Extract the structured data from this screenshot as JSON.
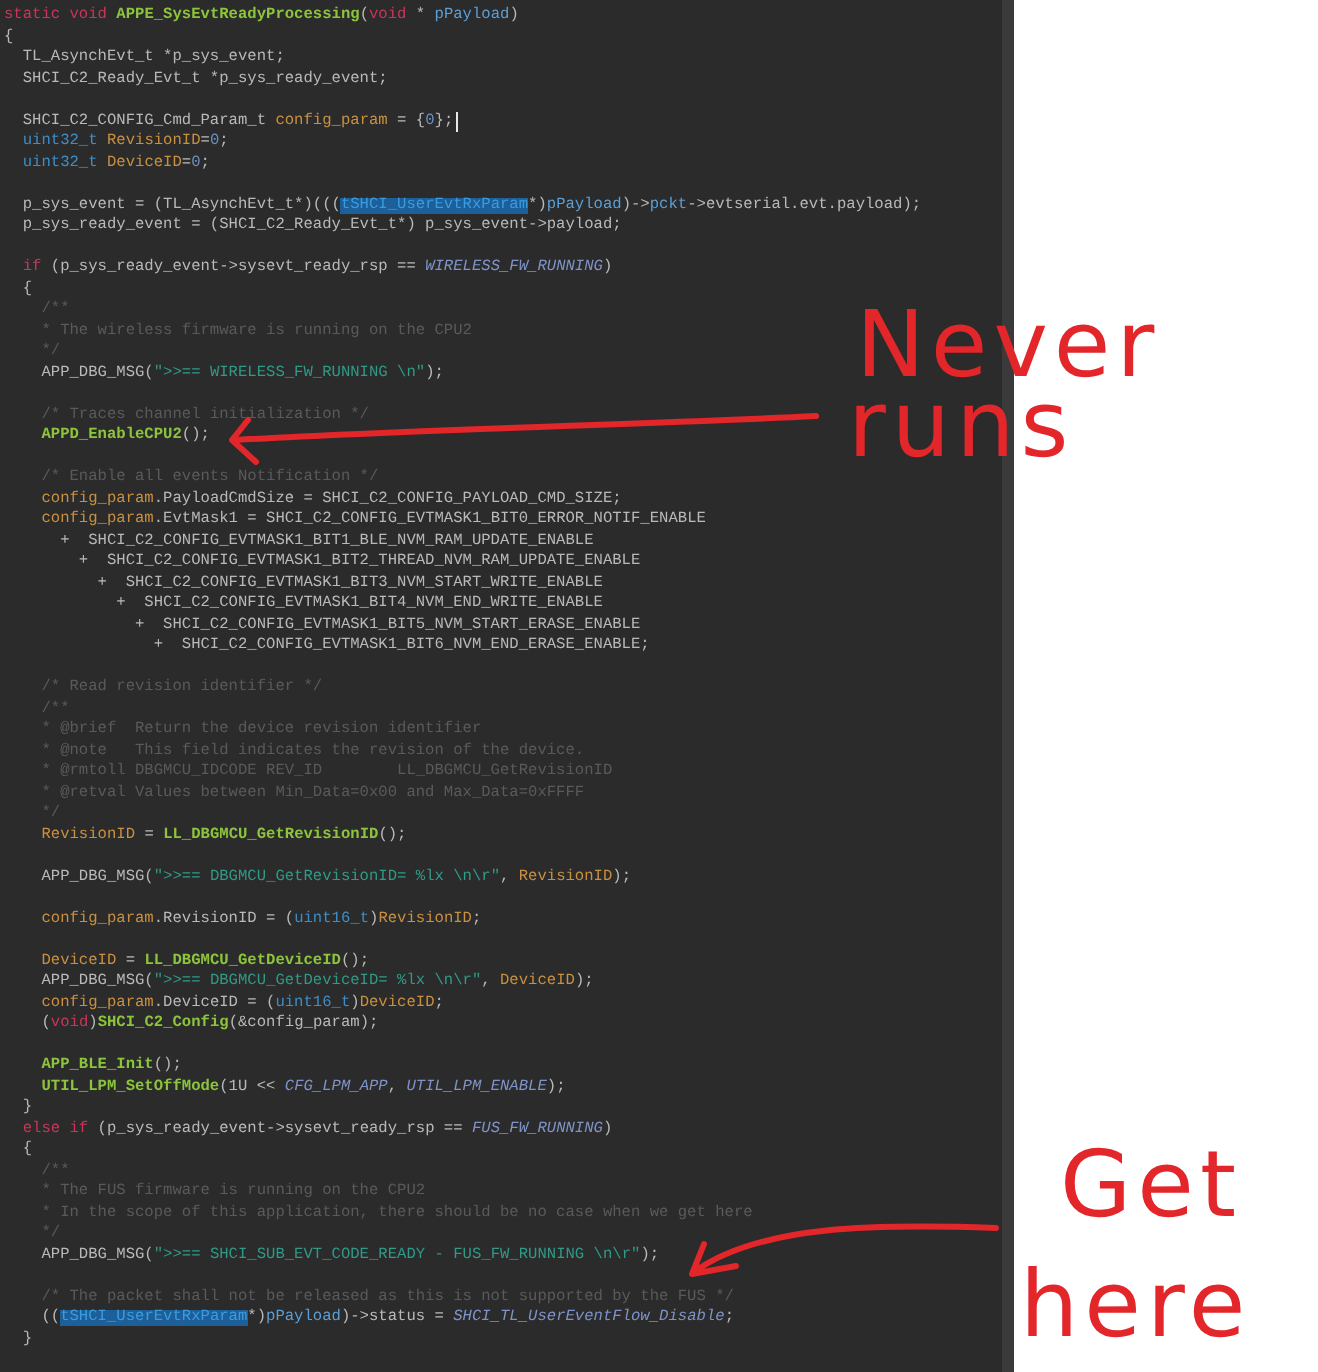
{
  "editor": {
    "lines": [
      {
        "kind": "code",
        "segments": [
          {
            "text": "static void ",
            "kind": "keyword"
          },
          {
            "text": "APPE_SysEvtReadyProcessing",
            "kind": "func"
          },
          {
            "text": "(",
            "kind": "plain"
          },
          {
            "text": "void",
            "kind": "keyword"
          },
          {
            "text": " * ",
            "kind": "plain"
          },
          {
            "text": "pPayload",
            "kind": "param"
          },
          {
            "text": ")",
            "kind": "plain"
          }
        ]
      },
      {
        "kind": "code",
        "segments": [
          {
            "text": "{",
            "kind": "plain"
          }
        ]
      },
      {
        "kind": "code",
        "segments": [
          {
            "text": "  TL_AsynchEvt_t *p_sys_event;",
            "kind": "plain"
          }
        ]
      },
      {
        "kind": "code",
        "segments": [
          {
            "text": "  SHCI_C2_Ready_Evt_t *p_sys_ready_event;",
            "kind": "plain"
          }
        ]
      },
      {
        "kind": "blank"
      },
      {
        "kind": "code",
        "cursor": true,
        "segments": [
          {
            "text": "  SHCI_C2_CONFIG_Cmd_Param_t ",
            "kind": "plain"
          },
          {
            "text": "config_param",
            "kind": "var"
          },
          {
            "text": " = {",
            "kind": "plain"
          },
          {
            "text": "0",
            "kind": "number"
          },
          {
            "text": "};",
            "kind": "plain"
          }
        ]
      },
      {
        "kind": "code",
        "segments": [
          {
            "text": "  uint32_t",
            "kind": "type"
          },
          {
            "text": " RevisionID",
            "kind": "var"
          },
          {
            "text": "=",
            "kind": "plain"
          },
          {
            "text": "0",
            "kind": "number"
          },
          {
            "text": ";",
            "kind": "plain"
          }
        ]
      },
      {
        "kind": "code",
        "segments": [
          {
            "text": "  uint32_t",
            "kind": "type"
          },
          {
            "text": " DeviceID",
            "kind": "var"
          },
          {
            "text": "=",
            "kind": "plain"
          },
          {
            "text": "0",
            "kind": "number"
          },
          {
            "text": ";",
            "kind": "plain"
          }
        ]
      },
      {
        "kind": "blank"
      },
      {
        "kind": "code",
        "segments": [
          {
            "text": "  p_sys_event = (TL_AsynchEvt_t*)(((",
            "kind": "plain"
          },
          {
            "text": "tSHCI_UserEvtRxParam",
            "kind": "selected"
          },
          {
            "text": "*)",
            "kind": "plain"
          },
          {
            "text": "pPayload",
            "kind": "param"
          },
          {
            "text": ")->",
            "kind": "plain"
          },
          {
            "text": "pckt",
            "kind": "param"
          },
          {
            "text": "->evtserial.evt.payload);",
            "kind": "plain"
          }
        ]
      },
      {
        "kind": "code",
        "segments": [
          {
            "text": "  p_sys_ready_event = (SHCI_C2_Ready_Evt_t*) p_sys_event->payload;",
            "kind": "plain"
          }
        ]
      },
      {
        "kind": "blank"
      },
      {
        "kind": "code",
        "segments": [
          {
            "text": "  if",
            "kind": "keyword"
          },
          {
            "text": " (p_sys_ready_event->sysevt_ready_rsp == ",
            "kind": "plain"
          },
          {
            "text": "WIRELESS_FW_RUNNING",
            "kind": "const"
          },
          {
            "text": ")",
            "kind": "plain"
          }
        ]
      },
      {
        "kind": "code",
        "segments": [
          {
            "text": "  {",
            "kind": "plain"
          }
        ]
      },
      {
        "kind": "code",
        "segments": [
          {
            "text": "    /**",
            "kind": "comment"
          }
        ]
      },
      {
        "kind": "code",
        "segments": [
          {
            "text": "    * The wireless firmware is running on the CPU2",
            "kind": "comment"
          }
        ]
      },
      {
        "kind": "code",
        "segments": [
          {
            "text": "    */",
            "kind": "comment"
          }
        ]
      },
      {
        "kind": "code",
        "segments": [
          {
            "text": "    APP_DBG_MSG(",
            "kind": "plain"
          },
          {
            "text": "\">>== WIRELESS_FW_RUNNING \\n\"",
            "kind": "string"
          },
          {
            "text": ");",
            "kind": "plain"
          }
        ]
      },
      {
        "kind": "blank"
      },
      {
        "kind": "code",
        "segments": [
          {
            "text": "    /* Traces channel initialization */",
            "kind": "comment"
          }
        ]
      },
      {
        "kind": "code",
        "segments": [
          {
            "text": "    APPD_EnableCPU2",
            "kind": "func"
          },
          {
            "text": "();",
            "kind": "plain"
          }
        ]
      },
      {
        "kind": "blank"
      },
      {
        "kind": "code",
        "segments": [
          {
            "text": "    /* Enable all events Notification */",
            "kind": "comment"
          }
        ]
      },
      {
        "kind": "code",
        "segments": [
          {
            "text": "    config_param",
            "kind": "var"
          },
          {
            "text": ".PayloadCmdSize = SHCI_C2_CONFIG_PAYLOAD_CMD_SIZE;",
            "kind": "plain"
          }
        ]
      },
      {
        "kind": "code",
        "segments": [
          {
            "text": "    config_param",
            "kind": "var"
          },
          {
            "text": ".EvtMask1 = SHCI_C2_CONFIG_EVTMASK1_BIT0_ERROR_NOTIF_ENABLE",
            "kind": "plain"
          }
        ]
      },
      {
        "kind": "code",
        "segments": [
          {
            "text": "      +  SHCI_C2_CONFIG_EVTMASK1_BIT1_BLE_NVM_RAM_UPDATE_ENABLE",
            "kind": "plain"
          }
        ]
      },
      {
        "kind": "code",
        "segments": [
          {
            "text": "        +  SHCI_C2_CONFIG_EVTMASK1_BIT2_THREAD_NVM_RAM_UPDATE_ENABLE",
            "kind": "plain"
          }
        ]
      },
      {
        "kind": "code",
        "segments": [
          {
            "text": "          +  SHCI_C2_CONFIG_EVTMASK1_BIT3_NVM_START_WRITE_ENABLE",
            "kind": "plain"
          }
        ]
      },
      {
        "kind": "code",
        "segments": [
          {
            "text": "            +  SHCI_C2_CONFIG_EVTMASK1_BIT4_NVM_END_WRITE_ENABLE",
            "kind": "plain"
          }
        ]
      },
      {
        "kind": "code",
        "segments": [
          {
            "text": "              +  SHCI_C2_CONFIG_EVTMASK1_BIT5_NVM_START_ERASE_ENABLE",
            "kind": "plain"
          }
        ]
      },
      {
        "kind": "code",
        "segments": [
          {
            "text": "                +  SHCI_C2_CONFIG_EVTMASK1_BIT6_NVM_END_ERASE_ENABLE;",
            "kind": "plain"
          }
        ]
      },
      {
        "kind": "blank"
      },
      {
        "kind": "code",
        "segments": [
          {
            "text": "    /* Read revision identifier */",
            "kind": "comment"
          }
        ]
      },
      {
        "kind": "code",
        "segments": [
          {
            "text": "    /**",
            "kind": "comment"
          }
        ]
      },
      {
        "kind": "code",
        "segments": [
          {
            "text": "    * @brief  Return the device revision identifier",
            "kind": "comment"
          }
        ]
      },
      {
        "kind": "code",
        "segments": [
          {
            "text": "    * @note   This field indicates the revision of the device.",
            "kind": "comment"
          }
        ]
      },
      {
        "kind": "code",
        "segments": [
          {
            "text": "    * @rmtoll DBGMCU_IDCODE REV_ID        LL_DBGMCU_GetRevisionID",
            "kind": "comment"
          }
        ]
      },
      {
        "kind": "code",
        "segments": [
          {
            "text": "    * @retval Values between Min_Data=0x00 and Max_Data=0xFFFF",
            "kind": "comment"
          }
        ]
      },
      {
        "kind": "code",
        "segments": [
          {
            "text": "    */",
            "kind": "comment"
          }
        ]
      },
      {
        "kind": "code",
        "segments": [
          {
            "text": "    RevisionID",
            "kind": "var"
          },
          {
            "text": " = ",
            "kind": "plain"
          },
          {
            "text": "LL_DBGMCU_GetRevisionID",
            "kind": "func"
          },
          {
            "text": "();",
            "kind": "plain"
          }
        ]
      },
      {
        "kind": "blank"
      },
      {
        "kind": "code",
        "segments": [
          {
            "text": "    APP_DBG_MSG(",
            "kind": "plain"
          },
          {
            "text": "\">>== DBGMCU_GetRevisionID= %lx \\n\\r\"",
            "kind": "string"
          },
          {
            "text": ", ",
            "kind": "plain"
          },
          {
            "text": "RevisionID",
            "kind": "var"
          },
          {
            "text": ");",
            "kind": "plain"
          }
        ]
      },
      {
        "kind": "blank"
      },
      {
        "kind": "code",
        "segments": [
          {
            "text": "    config_param",
            "kind": "var"
          },
          {
            "text": ".RevisionID = (",
            "kind": "plain"
          },
          {
            "text": "uint16_t",
            "kind": "type"
          },
          {
            "text": ")",
            "kind": "plain"
          },
          {
            "text": "RevisionID",
            "kind": "var"
          },
          {
            "text": ";",
            "kind": "plain"
          }
        ]
      },
      {
        "kind": "blank"
      },
      {
        "kind": "code",
        "segments": [
          {
            "text": "    DeviceID",
            "kind": "var"
          },
          {
            "text": " = ",
            "kind": "plain"
          },
          {
            "text": "LL_DBGMCU_GetDeviceID",
            "kind": "func"
          },
          {
            "text": "();",
            "kind": "plain"
          }
        ]
      },
      {
        "kind": "code",
        "segments": [
          {
            "text": "    APP_DBG_MSG(",
            "kind": "plain"
          },
          {
            "text": "\">>== DBGMCU_GetDeviceID= %lx \\n\\r\"",
            "kind": "string"
          },
          {
            "text": ", ",
            "kind": "plain"
          },
          {
            "text": "DeviceID",
            "kind": "var"
          },
          {
            "text": ");",
            "kind": "plain"
          }
        ]
      },
      {
        "kind": "code",
        "segments": [
          {
            "text": "    config_param",
            "kind": "var"
          },
          {
            "text": ".DeviceID = (",
            "kind": "plain"
          },
          {
            "text": "uint16_t",
            "kind": "type"
          },
          {
            "text": ")",
            "kind": "plain"
          },
          {
            "text": "DeviceID",
            "kind": "var"
          },
          {
            "text": ";",
            "kind": "plain"
          }
        ]
      },
      {
        "kind": "code",
        "segments": [
          {
            "text": "    (",
            "kind": "plain"
          },
          {
            "text": "void",
            "kind": "keyword"
          },
          {
            "text": ")",
            "kind": "plain"
          },
          {
            "text": "SHCI_C2_Config",
            "kind": "func"
          },
          {
            "text": "(&config_param);",
            "kind": "plain"
          }
        ]
      },
      {
        "kind": "blank"
      },
      {
        "kind": "code",
        "segments": [
          {
            "text": "    APP_BLE_Init",
            "kind": "func"
          },
          {
            "text": "();",
            "kind": "plain"
          }
        ]
      },
      {
        "kind": "code",
        "segments": [
          {
            "text": "    UTIL_LPM_SetOffMode",
            "kind": "func"
          },
          {
            "text": "(1U << ",
            "kind": "plain"
          },
          {
            "text": "CFG_LPM_APP",
            "kind": "const"
          },
          {
            "text": ", ",
            "kind": "plain"
          },
          {
            "text": "UTIL_LPM_ENABLE",
            "kind": "const"
          },
          {
            "text": ");",
            "kind": "plain"
          }
        ]
      },
      {
        "kind": "code",
        "segments": [
          {
            "text": "  }",
            "kind": "plain"
          }
        ]
      },
      {
        "kind": "code",
        "segments": [
          {
            "text": "  else if",
            "kind": "keyword"
          },
          {
            "text": " (p_sys_ready_event->sysevt_ready_rsp == ",
            "kind": "plain"
          },
          {
            "text": "FUS_FW_RUNNING",
            "kind": "const"
          },
          {
            "text": ")",
            "kind": "plain"
          }
        ]
      },
      {
        "kind": "code",
        "segments": [
          {
            "text": "  {",
            "kind": "plain"
          }
        ]
      },
      {
        "kind": "code",
        "segments": [
          {
            "text": "    /**",
            "kind": "comment"
          }
        ]
      },
      {
        "kind": "code",
        "segments": [
          {
            "text": "    * The FUS firmware is running on the CPU2",
            "kind": "comment"
          }
        ]
      },
      {
        "kind": "code",
        "segments": [
          {
            "text": "    * In the scope of this application, there should be no case when we get here",
            "kind": "comment"
          }
        ]
      },
      {
        "kind": "code",
        "segments": [
          {
            "text": "    */",
            "kind": "comment"
          }
        ]
      },
      {
        "kind": "code",
        "segments": [
          {
            "text": "    APP_DBG_MSG(",
            "kind": "plain"
          },
          {
            "text": "\">>== SHCI_SUB_EVT_CODE_READY - FUS_FW_RUNNING \\n\\r\"",
            "kind": "string"
          },
          {
            "text": ");",
            "kind": "plain"
          }
        ]
      },
      {
        "kind": "blank"
      },
      {
        "kind": "code",
        "segments": [
          {
            "text": "    /* The packet shall not be released as this is not supported by the FUS */",
            "kind": "comment"
          }
        ]
      },
      {
        "kind": "code",
        "segments": [
          {
            "text": "    ((",
            "kind": "plain"
          },
          {
            "text": "tSHCI_UserEvtRxParam",
            "kind": "selected"
          },
          {
            "text": "*)",
            "kind": "plain"
          },
          {
            "text": "pPayload",
            "kind": "param"
          },
          {
            "text": ")->status = ",
            "kind": "plain"
          },
          {
            "text": "SHCI_TL_UserEventFlow_Disable",
            "kind": "const"
          },
          {
            "text": ";",
            "kind": "plain"
          }
        ]
      },
      {
        "kind": "code",
        "segments": [
          {
            "text": "  }",
            "kind": "plain"
          }
        ]
      }
    ]
  },
  "annotations": [
    {
      "words": [
        "Never",
        "runs"
      ]
    },
    {
      "words": [
        "Get",
        "here"
      ]
    }
  ]
}
